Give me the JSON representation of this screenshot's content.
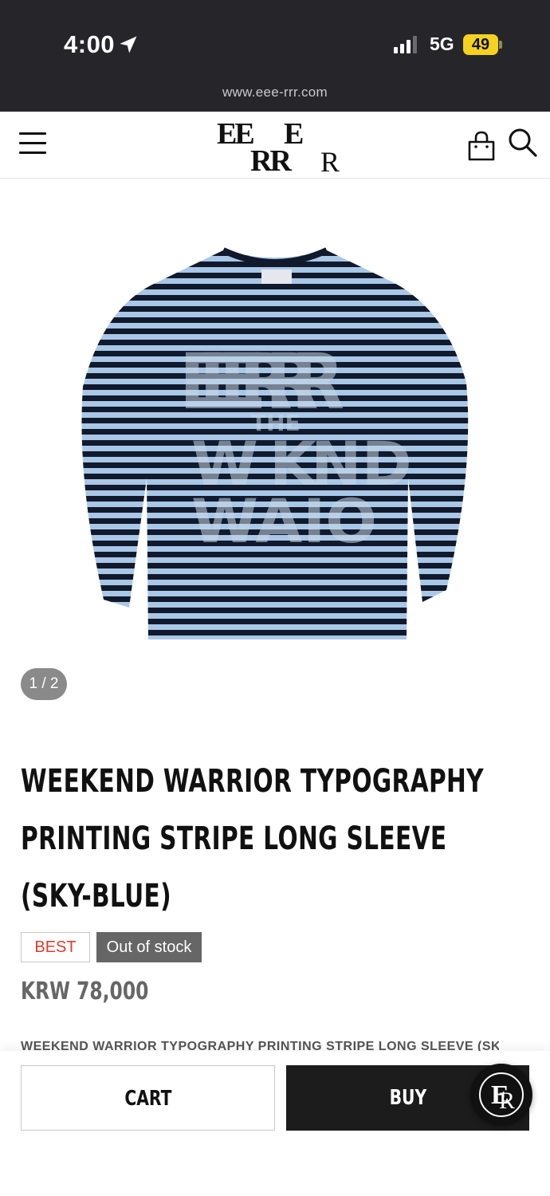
{
  "status_bar": {
    "time": "4:00",
    "network": "5G",
    "battery": "49"
  },
  "browser": {
    "url": "www.eee-rrr.com"
  },
  "header": {
    "logo_line1_a": "EE",
    "logo_line1_b": "E",
    "logo_line2_a": "RR",
    "logo_line2_b": "R"
  },
  "product": {
    "image_counter": "1 / 2",
    "title": "WEEKEND WARRIOR TYPOGRAPHY PRINTING STRIPE LONG SLEEVE (SKY-BLUE)",
    "badge_best": "BEST",
    "badge_stock": "Out of stock",
    "price": "KRW 78,000",
    "description_peek": "WEEKEND WARRIOR TYPOGRAPHY PRINTING STRIPE LONG SLEEVE (SKY"
  },
  "actions": {
    "cart_label": "CART",
    "buy_label": "BUY"
  },
  "colors": {
    "status_bar_bg": "#26262a",
    "stripe_dark": "#111a2c",
    "stripe_light": "#a9c7e6",
    "badge_best_text": "#e23b2e",
    "badge_stock_bg": "#666666",
    "buy_bg": "#1c1c1c"
  },
  "icons": [
    "location-arrow-icon",
    "signal-icon",
    "menu-icon",
    "bag-icon",
    "search-icon",
    "brand-monogram-icon"
  ]
}
